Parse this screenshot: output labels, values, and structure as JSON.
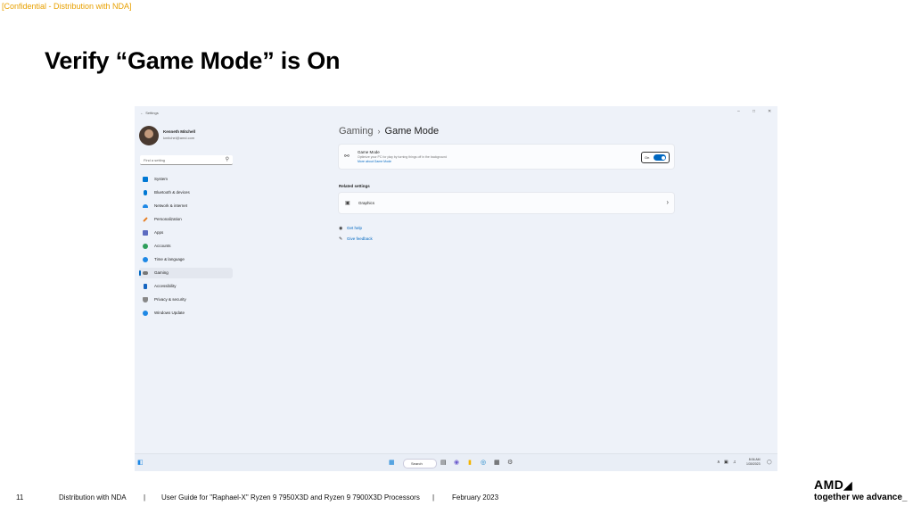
{
  "slide": {
    "confidential": "[Confidential - Distribution with NDA]",
    "title": "Verify “Game Mode” is On",
    "footer": {
      "page_number": "11",
      "distribution": "Distribution with NDA",
      "sep1": "|",
      "guide": "User Guide for \"Raphael-X\" Ryzen 9 7950X3D and Ryzen 9 7900X3D Processors",
      "sep2": "|",
      "date": "February 2023"
    },
    "logo": "AMD",
    "tagline": "together we advance_"
  },
  "window": {
    "title": "Settings",
    "controls": {
      "minimize": "–",
      "maximize": "□",
      "close": "✕"
    }
  },
  "user": {
    "name": "Kenneth Mitchell",
    "email": "kmitchel@amd.com"
  },
  "search": {
    "placeholder": "Find a setting",
    "icon": "search-icon"
  },
  "sidebar": {
    "items": [
      {
        "label": "System",
        "icon": "system-icon",
        "color": "#0078d4",
        "active": false
      },
      {
        "label": "Bluetooth & devices",
        "icon": "bluetooth-icon",
        "color": "#0078d4",
        "active": false
      },
      {
        "label": "Network & internet",
        "icon": "wifi-icon",
        "color": "#1e88e5",
        "active": false
      },
      {
        "label": "Personalization",
        "icon": "brush-icon",
        "color": "#e67e22",
        "active": false
      },
      {
        "label": "Apps",
        "icon": "apps-icon",
        "color": "#5c6bc0",
        "active": false
      },
      {
        "label": "Accounts",
        "icon": "account-icon",
        "color": "#2e9e5b",
        "active": false
      },
      {
        "label": "Time & language",
        "icon": "globe-icon",
        "color": "#1e88e5",
        "active": false
      },
      {
        "label": "Gaming",
        "icon": "gamepad-icon",
        "color": "#777777",
        "active": true
      },
      {
        "label": "Accessibility",
        "icon": "accessibility-icon",
        "color": "#1565c0",
        "active": false
      },
      {
        "label": "Privacy & security",
        "icon": "shield-icon",
        "color": "#888888",
        "active": false
      },
      {
        "label": "Windows Update",
        "icon": "update-icon",
        "color": "#1e88e5",
        "active": false
      }
    ]
  },
  "breadcrumb": {
    "parent": "Gaming",
    "separator": "›",
    "current": "Game Mode"
  },
  "game_mode": {
    "title": "Game Mode",
    "description": "Optimize your PC for play by turning things off in the background",
    "link": "More about Game Mode",
    "toggle_label": "On",
    "toggle_on": true
  },
  "related": {
    "heading": "Related settings",
    "graphics_label": "Graphics"
  },
  "help": {
    "get_help": "Get help",
    "give_feedback": "Give feedback"
  },
  "taskbar": {
    "search_label": "Search",
    "tray_chevron": "∧",
    "time": "8:06 AM",
    "date": "1/30/2023"
  }
}
